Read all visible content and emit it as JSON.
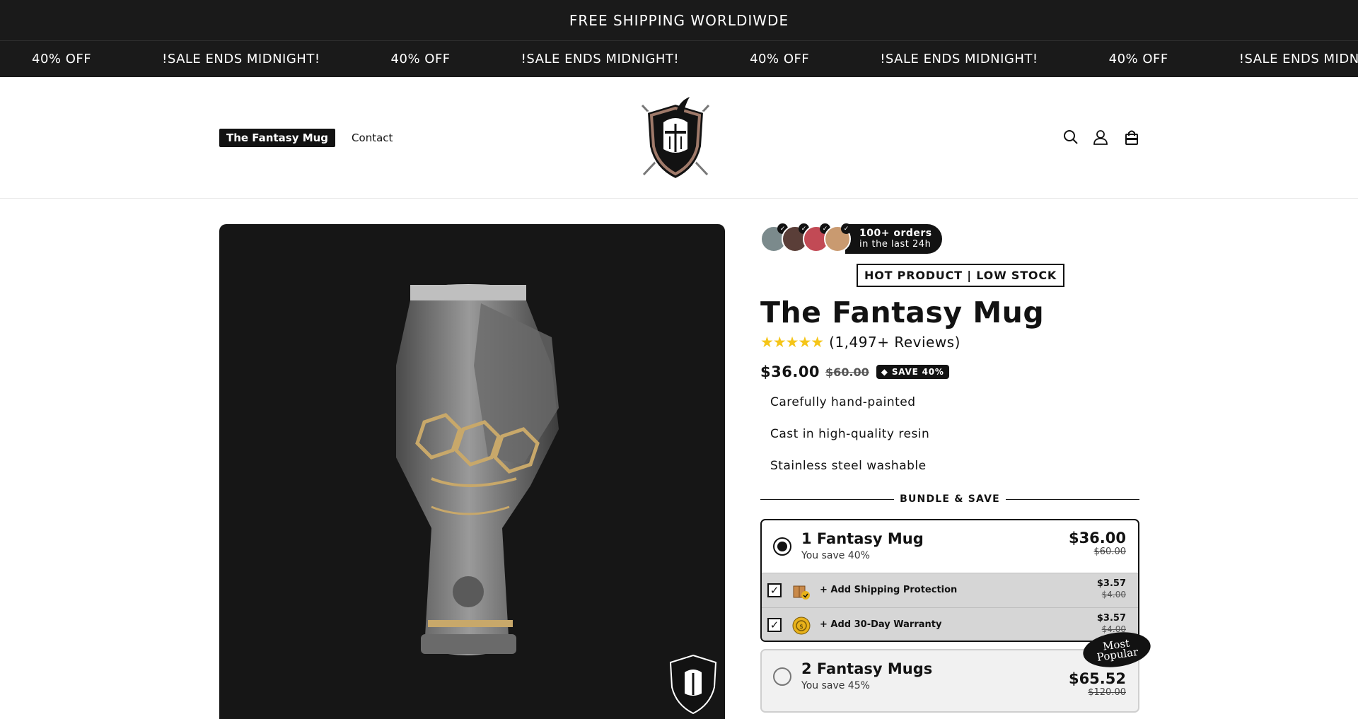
{
  "announcement": {
    "text": "FREE SHIPPING WORLDIWDE"
  },
  "ticker": {
    "items": [
      "40% OFF",
      "!SALE ENDS MIDNIGHT!",
      "40% OFF",
      "!SALE ENDS MIDNIGHT!",
      "40% OFF",
      "!SALE ENDS MIDNIGHT!",
      "40% OFF",
      "!SALE ENDS MIDNIGHT!"
    ]
  },
  "header": {
    "nav": [
      {
        "label": "The Fantasy Mug",
        "active": true
      },
      {
        "label": "Contact",
        "active": false
      }
    ],
    "logo_icon": "knight-helmet-shield-logo",
    "icons": [
      "search-icon",
      "account-icon",
      "cart-icon"
    ]
  },
  "product": {
    "social_proof": {
      "line1": "100+ orders",
      "line2": "in the last 24h"
    },
    "tag": "HOT PRODUCT | LOW STOCK",
    "title": "The Fantasy Mug",
    "rating": {
      "stars": 5,
      "text": "(1,497+ Reviews)"
    },
    "price": "$36.00",
    "compare_price": "$60.00",
    "save_badge": "SAVE 40%",
    "features": [
      "Carefully hand-painted",
      "Cast in high-quality resin",
      "Stainless steel washable"
    ],
    "bundle_heading": "BUNDLE & SAVE",
    "bundles": [
      {
        "title": "1 Fantasy Mug",
        "subtitle": "You save 40%",
        "price": "$36.00",
        "compare": "$60.00",
        "selected": true,
        "addons": [
          {
            "label": "+ Add Shipping Protection",
            "price": "$3.57",
            "compare": "$4.00",
            "icon": "package-shield-icon"
          },
          {
            "label": "+ Add 30-Day Warranty",
            "price": "$3.57",
            "compare": "$4.00",
            "icon": "warranty-seal-icon"
          }
        ]
      },
      {
        "title": "2 Fantasy Mugs",
        "subtitle": "You save 45%",
        "price": "$65.52",
        "compare": "$120.00",
        "selected": false,
        "badge": [
          "Most",
          "Popular"
        ]
      }
    ]
  },
  "colors": {
    "dark": "#121212",
    "star": "#f5c518",
    "addon_bg": "#d6d6d6"
  }
}
